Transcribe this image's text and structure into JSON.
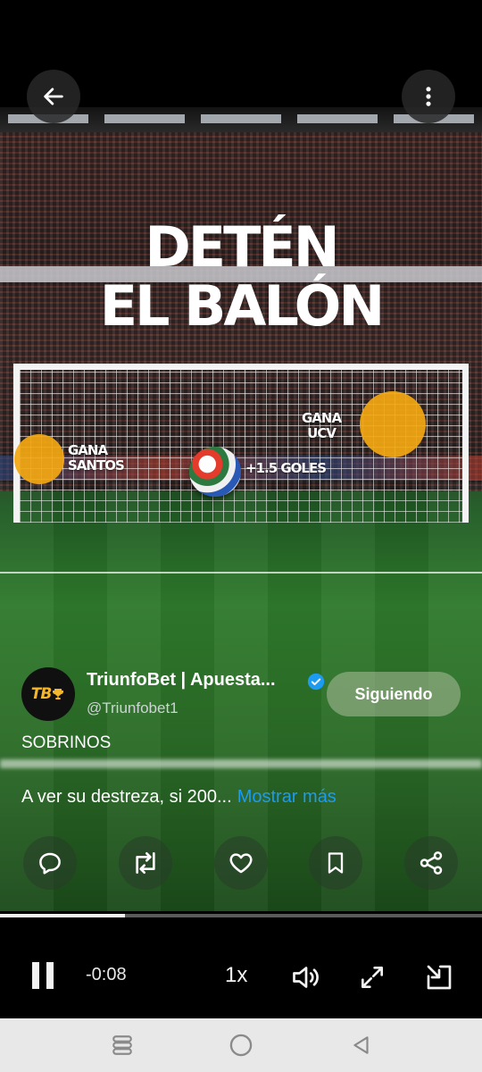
{
  "video": {
    "headline_line1": "DETÉN",
    "headline_line2": "EL BALÓN",
    "target_left_label_line1": "GANA",
    "target_left_label_line2": "SANTOS",
    "target_right_label_line1": "GANA",
    "target_right_label_line2": "UCV",
    "ball_label": "+1.5 GOLES",
    "target_color": "#f4a812"
  },
  "top_bar": {
    "back_icon": "arrow-left-icon",
    "more_icon": "more-vertical-icon"
  },
  "post": {
    "author_name": "TriunfoBet | Apuesta...",
    "author_handle": "@Triunfobet1",
    "avatar_text": "TB",
    "avatar_icon": "trophy-icon",
    "verified_icon": "verified-badge-icon",
    "follow_label": "Siguiendo",
    "caption_title": "SOBRINOS",
    "caption_text": "A ver su destreza, si 200...",
    "show_more_label": "Mostrar más",
    "link_color": "#1d9bf0"
  },
  "actions": {
    "reply_icon": "reply-icon",
    "repost_icon": "repost-icon",
    "like_icon": "heart-icon",
    "bookmark_icon": "bookmark-icon",
    "share_icon": "share-icon"
  },
  "player": {
    "progress_fraction": 0.26,
    "time_remaining": "-0:08",
    "speed": "1x",
    "pause_icon": "pause-icon",
    "volume_icon": "volume-icon",
    "fullscreen_icon": "fullscreen-icon",
    "pip_icon": "picture-in-picture-icon"
  },
  "system_nav": {
    "recents_icon": "recents-icon",
    "home_icon": "home-icon",
    "back_icon": "back-triangle-icon"
  }
}
